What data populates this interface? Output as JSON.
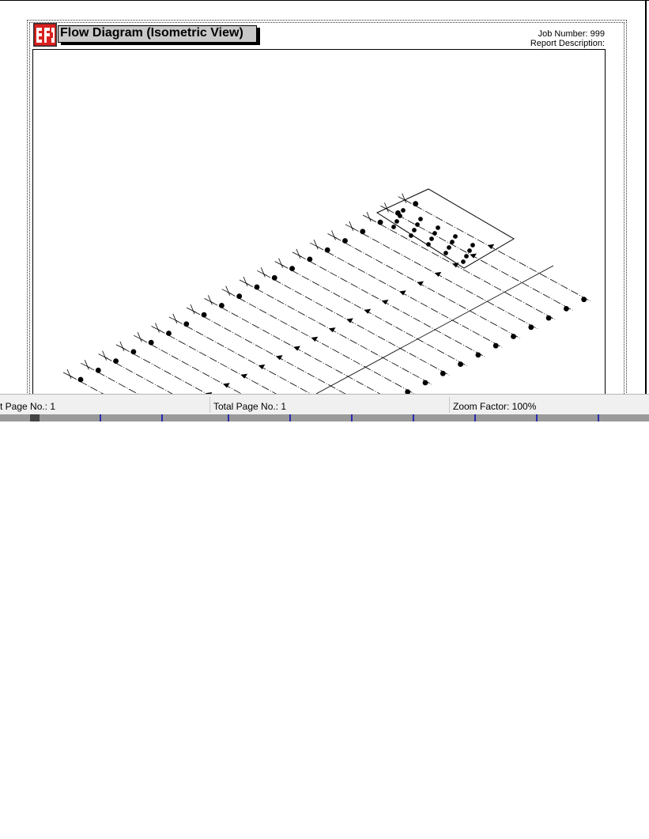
{
  "report": {
    "title": "Flow Diagram (Isometric View)",
    "job_number": "Job Number: 999",
    "report_description": "Report Description:"
  },
  "status_bar": {
    "current_page": "t Page No.: 1",
    "total_pages": "Total Page No.: 1",
    "zoom": "Zoom Factor: 100%"
  },
  "colors": {
    "logo_red": "#d8211f",
    "title_gray": "#c8c8c8",
    "scrollbar_tick": "#2a2ab0"
  }
}
